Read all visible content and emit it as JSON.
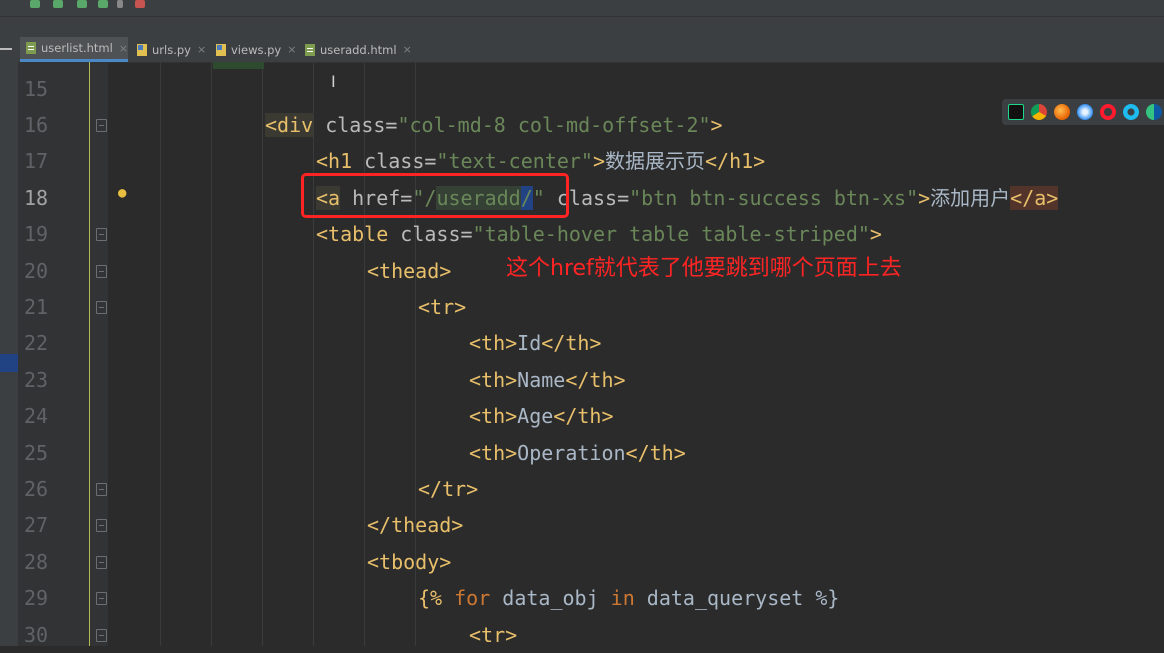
{
  "tabs": [
    {
      "label": "userlist.html",
      "active": true,
      "icon": "html-file-icon"
    },
    {
      "label": "urls.py",
      "active": false,
      "icon": "python-file-icon"
    },
    {
      "label": "views.py",
      "active": false,
      "icon": "python-file-icon"
    },
    {
      "label": "useradd.html",
      "active": false,
      "icon": "html-file-icon"
    }
  ],
  "tab_close_glyph": "×",
  "line_numbers": [
    "15",
    "16",
    "17",
    "18",
    "19",
    "20",
    "21",
    "22",
    "23",
    "24",
    "25",
    "26",
    "27",
    "28",
    "29",
    "30"
  ],
  "current_line": "18",
  "code": {
    "l16_open": "<div",
    "l16_attr": " class=",
    "l16_val": "\"col-md-8 col-md-offset-2\"",
    "l16_close": ">",
    "l17_open": "<h1",
    "l17_attr": " class=",
    "l17_val": "\"text-center\"",
    "l17_mid": ">",
    "l17_text": "数据展示页",
    "l17_end": "</h1>",
    "l18_open": "<a",
    "l18_attr": " href=",
    "l18_q1": "\"/",
    "l18_word": "useradd",
    "l18_slash": "/",
    "l18_q2": "\"",
    "l18_attr2": " class=",
    "l18_val2": "\"btn btn-success btn-xs\"",
    "l18_mid": ">",
    "l18_text": "添加用户",
    "l18_end": "</a>",
    "l19_open": "<table",
    "l19_attr": " class=",
    "l19_val": "\"table-hover table table-striped\"",
    "l19_close": ">",
    "l20": "<thead>",
    "l21": "<tr>",
    "l22_open": "<th>",
    "l22_text": "Id",
    "l22_end": "</th>",
    "l23_open": "<th>",
    "l23_text": "Name",
    "l23_end": "</th>",
    "l24_open": "<th>",
    "l24_text": "Age",
    "l24_end": "</th>",
    "l25_open": "<th>",
    "l25_text": "Operation",
    "l25_end": "</th>",
    "l26": "</tr>",
    "l27": "</thead>",
    "l28": "<tbody>",
    "l29_a": "{% ",
    "l29_for": "for",
    "l29_b": " data_obj ",
    "l29_in": "in",
    "l29_c": " data_queryset %}",
    "l30": "<tr>"
  },
  "annotation": "这个href就代表了他要跳到哪个页面上去",
  "browser_icons": [
    "pycharm-icon",
    "chrome-icon",
    "firefox-icon",
    "safari-icon",
    "opera-icon",
    "ie-icon",
    "edge-icon"
  ],
  "colors": {
    "editor_bg": "#2b2b2b",
    "tag": "#e8bf6a",
    "string": "#6a8759",
    "keyword": "#cc7832",
    "annotation_red": "#ff2424"
  }
}
